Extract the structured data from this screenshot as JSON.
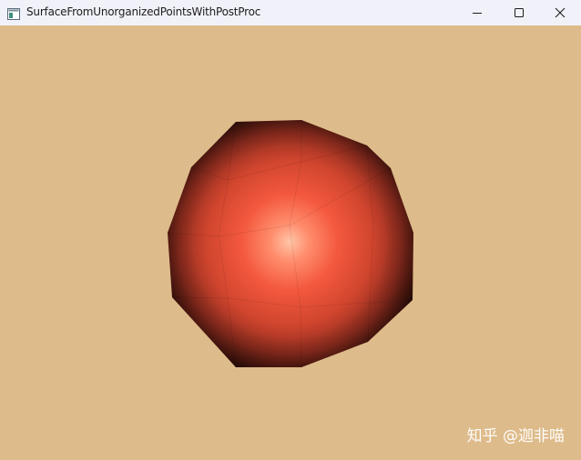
{
  "window": {
    "title": "SurfaceFromUnorganizedPointsWithPostProc",
    "controls": {
      "minimize_icon": "minimize-icon",
      "maximize_icon": "maximize-icon",
      "close_icon": "close-icon"
    }
  },
  "viewport": {
    "background_color": "#debb8a",
    "object_color": "#ff6a4a",
    "object": "shaded-polyhedral-sphere"
  },
  "watermark": {
    "text": "知乎 @迦非喵"
  }
}
